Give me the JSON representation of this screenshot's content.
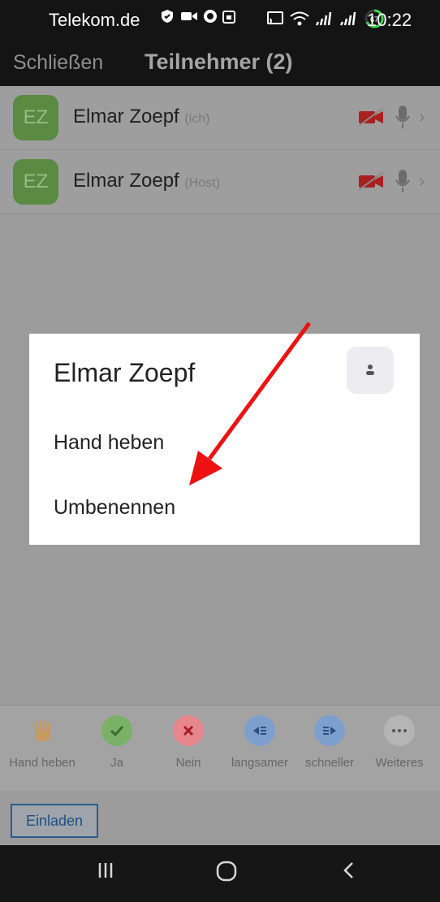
{
  "status": {
    "carrier": "Telekom.de",
    "battery": "67",
    "time": "10:22"
  },
  "header": {
    "close_label": "Schließen",
    "title": "Teilnehmer (2)"
  },
  "participants": [
    {
      "initials": "EZ",
      "name": "Elmar Zoepf",
      "role": "(ich)"
    },
    {
      "initials": "EZ",
      "name": "Elmar Zoepf",
      "role": "(Host)"
    }
  ],
  "dialog": {
    "title": "Elmar Zoepf",
    "items": [
      "Hand heben",
      "Umbenennen"
    ]
  },
  "toolbar": {
    "items": [
      {
        "label": "Hand heben",
        "icon": "raise-hand-icon",
        "color": "#c69a63"
      },
      {
        "label": "Ja",
        "icon": "check-icon",
        "color": "#79b166"
      },
      {
        "label": "Nein",
        "icon": "x-icon",
        "color": "#e7868c"
      },
      {
        "label": "langsamer",
        "icon": "rewind-icon",
        "color": "#7d9fcd"
      },
      {
        "label": "schneller",
        "icon": "fast-forward-icon",
        "color": "#7d9fcd"
      },
      {
        "label": "Weiteres",
        "icon": "more-icon",
        "color": "#b5b5b5"
      }
    ]
  },
  "invite_label": "Einladen",
  "colors": {
    "accent": "#2b5c8e",
    "arrow": "#ee1111",
    "avatar": "#5b8a43",
    "video_off": "#a82020"
  }
}
